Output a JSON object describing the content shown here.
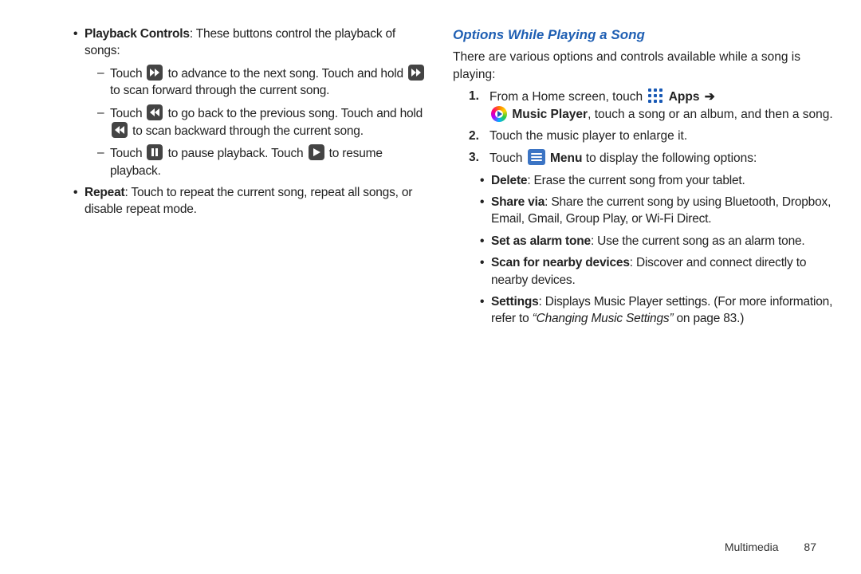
{
  "left": {
    "playback": {
      "label": "Playback Controls",
      "desc": ": These buttons control the playback of songs:",
      "items": [
        {
          "pre": "Touch",
          "mid": "to advance to the next song. Touch and hold",
          "post": "to scan forward through the current song."
        },
        {
          "pre": "Touch",
          "mid": "to go back to the previous song. Touch and hold",
          "post": "to scan backward through the current song."
        },
        {
          "pre": "Touch",
          "mid": "to pause playback. Touch",
          "post": "to resume playback."
        }
      ]
    },
    "repeat": {
      "label": "Repeat",
      "desc": ": Touch to repeat the current song, repeat all songs, or disable repeat mode."
    }
  },
  "right": {
    "heading": "Options While Playing a Song",
    "intro": "There are various options and controls available while a song is playing:",
    "steps": {
      "s1": {
        "num": "1.",
        "a": "From a Home screen, touch",
        "apps": "Apps",
        "arrow": "➔",
        "b": "Music Player",
        "c": ", touch a song or an album, and then a song."
      },
      "s2": {
        "num": "2.",
        "text": "Touch the music player to enlarge it."
      },
      "s3": {
        "num": "3.",
        "a": "Touch",
        "menu": "Menu",
        "b": "to display the following options:"
      }
    },
    "bullets": {
      "delete": {
        "label": "Delete",
        "desc": ": Erase the current song from your tablet."
      },
      "share": {
        "label": "Share via",
        "desc": ": Share the current song by using Bluetooth, Dropbox, Email, Gmail, Group Play, or Wi-Fi Direct."
      },
      "alarm": {
        "label": "Set as alarm tone",
        "desc": ": Use the current song as an alarm tone."
      },
      "scan": {
        "label": "Scan for nearby devices",
        "desc": ": Discover and connect directly to nearby devices."
      },
      "settings": {
        "label": "Settings",
        "desc1": ": Displays Music Player settings. (For more information, refer to ",
        "ref": "“Changing Music Settings”",
        "desc2": " on page 83.)"
      }
    }
  },
  "footer": {
    "section": "Multimedia",
    "page": "87"
  }
}
